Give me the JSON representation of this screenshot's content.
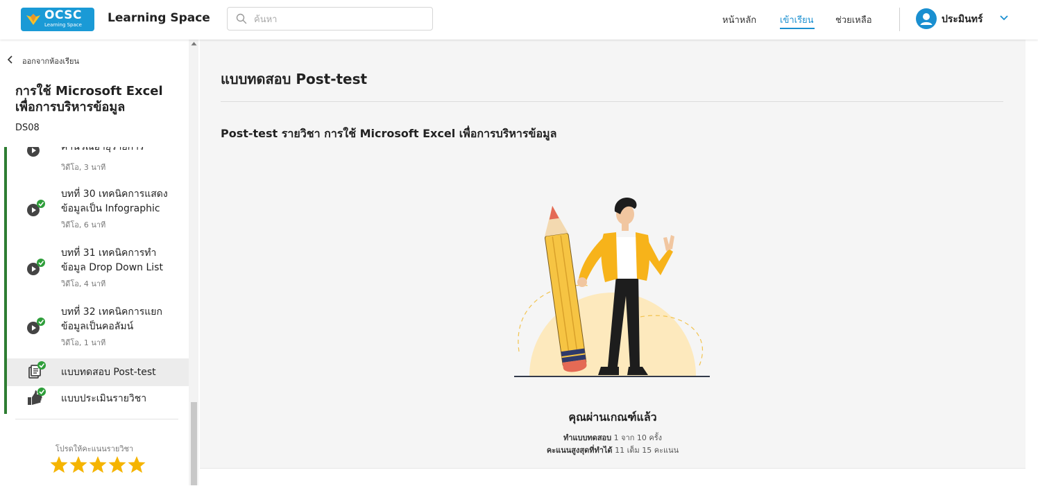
{
  "header": {
    "logo_text": "OCSC",
    "logo_subtext": "Learning Space",
    "app_title": "Learning Space",
    "search_placeholder": "ค้นหา",
    "nav": [
      {
        "label": "หน้าหลัก"
      },
      {
        "label": "เข้าเรียน"
      },
      {
        "label": "ช่วยเหลือ"
      }
    ],
    "user_name": "ประมินทร์",
    "accent_color": "#1a8fd0"
  },
  "sidebar": {
    "back_label": "ออกจากห้องเรียน",
    "course_title_line1": "การใช้ Microsoft Excel",
    "course_title_line2": "เพื่อการบริหารข้อมูล",
    "course_code": "DS08",
    "lessons": [
      {
        "title": "คำนวณอายุรายการ",
        "meta": "วิดีโอ, 3 นาที",
        "icon": "play-icon"
      },
      {
        "title_line1": "บทที่ 30 เทคนิคการแสดง",
        "title_line2": "ข้อมูลเป็น Infographic",
        "meta": "วิดีโอ, 6 นาที",
        "icon": "play-icon"
      },
      {
        "title_line1": "บทที่ 31 เทคนิคการทำ",
        "title_line2": "ข้อมูล Drop Down List",
        "meta": "วิดีโอ, 4 นาที",
        "icon": "play-icon"
      },
      {
        "title_line1": "บทที่ 32 เทคนิคการแยก",
        "title_line2": "ข้อมูลเป็นคอลัมน์",
        "meta": "วิดีโอ, 1 นาที",
        "icon": "play-icon"
      },
      {
        "title": "แบบทดสอบ Post-test",
        "icon": "quiz-icon",
        "active": true
      },
      {
        "title": "แบบประเมินรายวิชา",
        "icon": "thumbs-up-icon"
      }
    ],
    "rate_label": "โปรดให้คะแนนรายวิชา",
    "rating_stars": 5
  },
  "main": {
    "title": "แบบทดสอบ Post-test",
    "quiz_title": "Post-test รายวิชา การใช้ Microsoft Excel เพื่อการบริหารข้อมูล",
    "result_title": "คุณผ่านเกณฑ์แล้ว",
    "attempts_label": "ทำแบบทดสอบ",
    "attempts_value": "1 จาก 10 ครั้ง",
    "score_label": "คะแนนสูงสุดที่ทำได้",
    "score_value": "11 เต็ม 15 คะแนน"
  }
}
